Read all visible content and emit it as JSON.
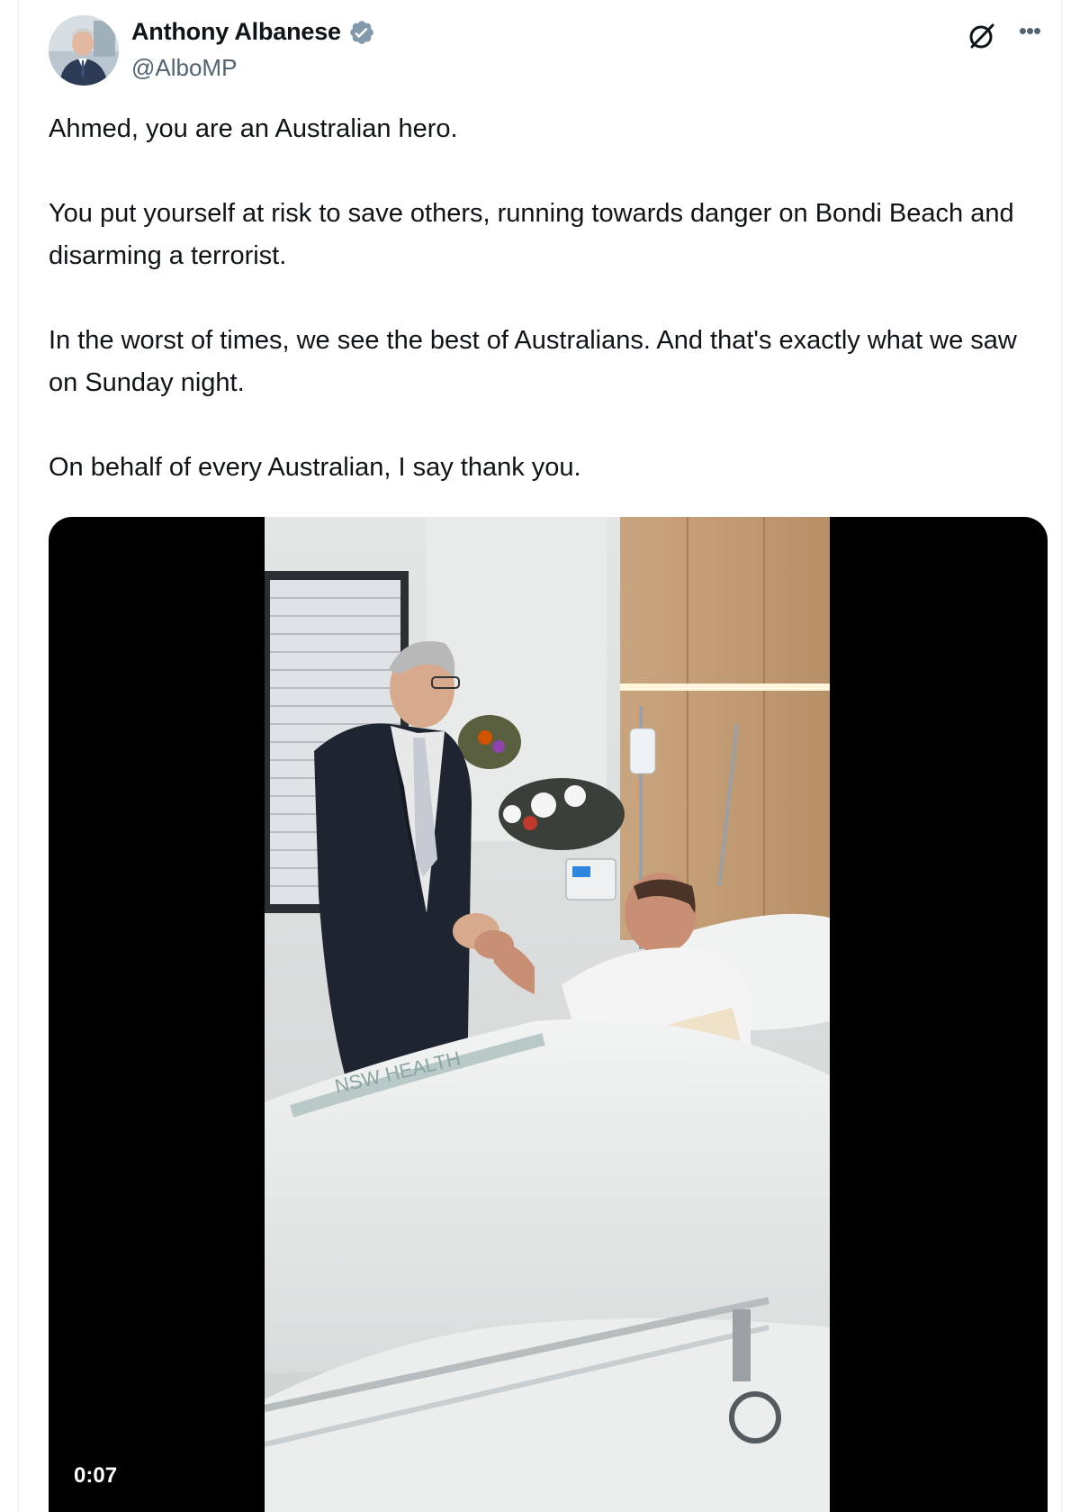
{
  "author": {
    "display_name": "Anthony Albanese",
    "handle": "@AlboMP",
    "verified": true,
    "verified_color": "#829aab"
  },
  "tweet": {
    "paragraphs": [
      "Ahmed, you are an Australian hero.",
      "You put yourself at risk to save others, running towards danger on Bondi Beach and disarming a terrorist.",
      "In the worst of times, we see the best of Australians. And that's exactly what we saw on Sunday night.",
      "On behalf of every Australian, I say thank you."
    ]
  },
  "media": {
    "type": "video",
    "timestamp": "0:07",
    "bed_sheet_text": "NSW HEALTH"
  },
  "icons": {
    "verified": "verified-badge-icon",
    "grok": "grok-icon",
    "more": "more-options-icon"
  }
}
